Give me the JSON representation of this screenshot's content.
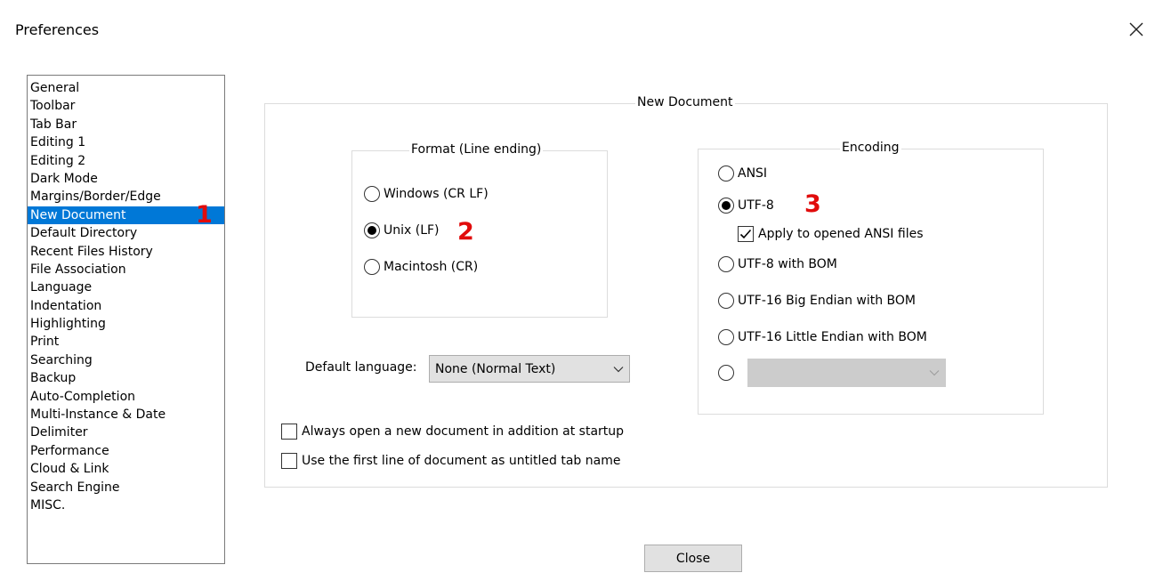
{
  "window": {
    "title": "Preferences",
    "close_icon": "close-icon"
  },
  "sidebar": {
    "selected_index": 7,
    "items": [
      {
        "label": "General"
      },
      {
        "label": "Toolbar"
      },
      {
        "label": "Tab Bar"
      },
      {
        "label": "Editing 1"
      },
      {
        "label": "Editing 2"
      },
      {
        "label": "Dark Mode"
      },
      {
        "label": "Margins/Border/Edge"
      },
      {
        "label": "New Document"
      },
      {
        "label": "Default Directory"
      },
      {
        "label": "Recent Files History"
      },
      {
        "label": "File Association"
      },
      {
        "label": "Language"
      },
      {
        "label": "Indentation"
      },
      {
        "label": "Highlighting"
      },
      {
        "label": "Print"
      },
      {
        "label": "Searching"
      },
      {
        "label": "Backup"
      },
      {
        "label": "Auto-Completion"
      },
      {
        "label": "Multi-Instance & Date"
      },
      {
        "label": "Delimiter"
      },
      {
        "label": "Performance"
      },
      {
        "label": "Cloud & Link"
      },
      {
        "label": "Search Engine"
      },
      {
        "label": "MISC."
      }
    ]
  },
  "annotations": {
    "one": "1",
    "two": "2",
    "three": "3",
    "color": "#e10c0c"
  },
  "new_document": {
    "group_label": "New Document",
    "format": {
      "label": "Format (Line ending)",
      "options": [
        {
          "label": "Windows (CR LF)",
          "selected": false
        },
        {
          "label": "Unix (LF)",
          "selected": true
        },
        {
          "label": "Macintosh (CR)",
          "selected": false
        }
      ]
    },
    "encoding": {
      "label": "Encoding",
      "options": [
        {
          "label": "ANSI",
          "selected": false
        },
        {
          "label": "UTF-8",
          "selected": true
        },
        {
          "label": "UTF-8 with BOM",
          "selected": false
        },
        {
          "label": "UTF-16 Big Endian with BOM",
          "selected": false
        },
        {
          "label": "UTF-16 Little Endian with BOM",
          "selected": false
        },
        {
          "label": "",
          "selected": false
        }
      ],
      "apply_ansi": {
        "label": "Apply to opened ANSI files",
        "checked": true
      },
      "other_combo_value": ""
    },
    "default_language": {
      "label": "Default language:",
      "value": "None (Normal Text)"
    },
    "always_open": {
      "label": "Always open a new document in addition at startup",
      "checked": false
    },
    "first_line_tab": {
      "label": "Use the first line of document as untitled tab name",
      "checked": false
    }
  },
  "footer": {
    "close_label": "Close"
  },
  "colors": {
    "selection": "#0078d7",
    "button_bg": "#e1e1e1",
    "group_border": "#dcdcdc"
  }
}
